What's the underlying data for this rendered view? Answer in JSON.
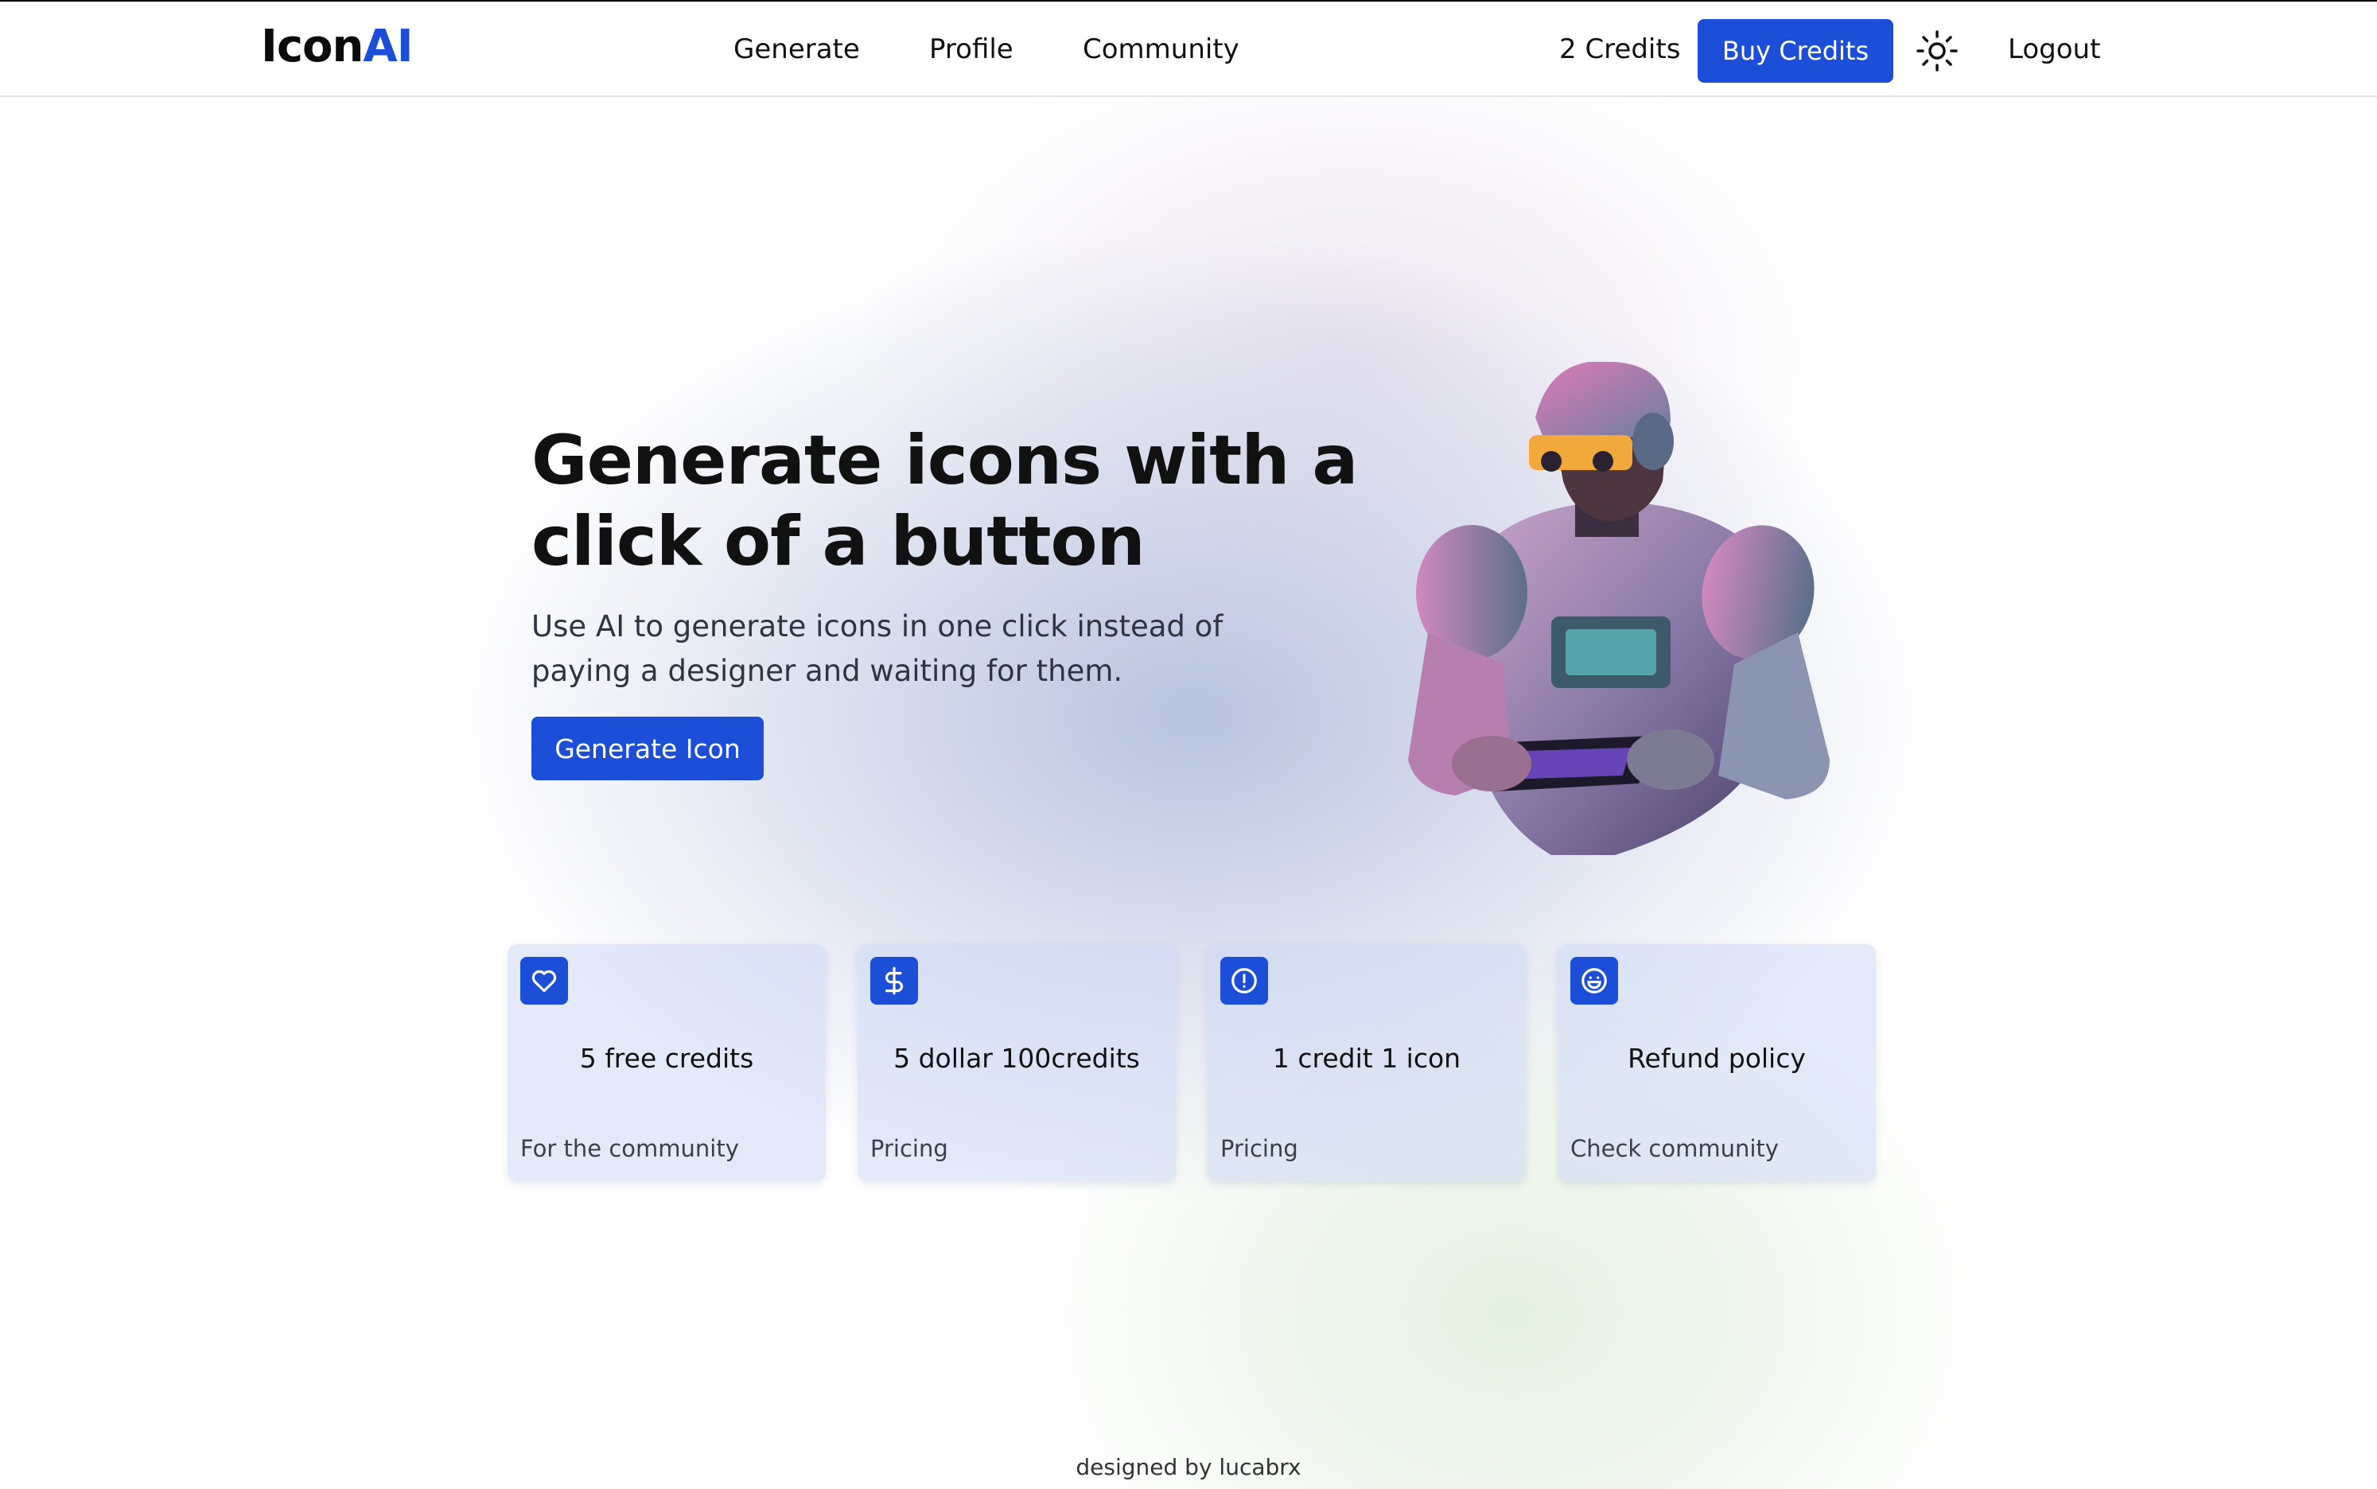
{
  "header": {
    "logo_text": "Icon",
    "logo_accent": "AI",
    "nav": [
      "Generate",
      "Profile",
      "Community"
    ],
    "credits": "2 Credits",
    "buy_label": "Buy Credits",
    "theme_icon": "sun-icon",
    "logout_label": "Logout"
  },
  "hero": {
    "title": "Generate icons with a click of a button",
    "subtitle": "Use AI to generate icons in one click instead of paying a designer and waiting for them.",
    "cta_label": "Generate Icon",
    "image": "robot-illustration"
  },
  "cards": [
    {
      "icon": "heart-icon",
      "title": "5 free credits",
      "footer": "For the community"
    },
    {
      "icon": "dollar-icon",
      "title": "5 dollar 100credits",
      "footer": "Pricing"
    },
    {
      "icon": "alert-circle-icon",
      "title": "1 credit 1 icon",
      "footer": "Pricing"
    },
    {
      "icon": "smile-icon",
      "title": "Refund policy",
      "footer": "Check community"
    }
  ],
  "footer": {
    "text": "designed by lucabrx"
  },
  "colors": {
    "accent": "#1d4ed8",
    "text": "#111111"
  }
}
